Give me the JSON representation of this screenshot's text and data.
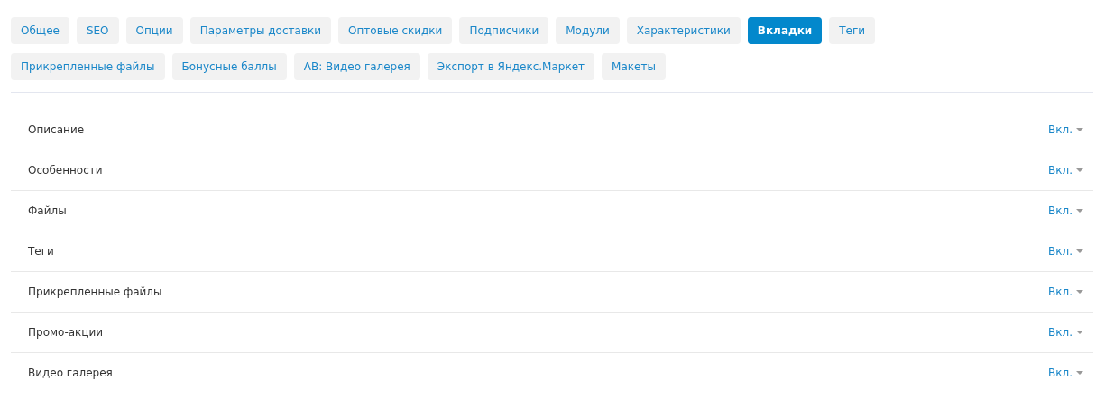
{
  "tabs": [
    {
      "label": "Общее",
      "selected": false
    },
    {
      "label": "SEO",
      "selected": false
    },
    {
      "label": "Опции",
      "selected": false
    },
    {
      "label": "Параметры доставки",
      "selected": false
    },
    {
      "label": "Оптовые скидки",
      "selected": false
    },
    {
      "label": "Подписчики",
      "selected": false
    },
    {
      "label": "Модули",
      "selected": false
    },
    {
      "label": "Характеристики",
      "selected": false
    },
    {
      "label": "Вкладки",
      "selected": true
    },
    {
      "label": "Теги",
      "selected": false
    },
    {
      "label": "Прикрепленные файлы",
      "selected": false
    },
    {
      "label": "Бонусные баллы",
      "selected": false
    },
    {
      "label": "AB: Видео галерея",
      "selected": false
    },
    {
      "label": "Экспорт в Яндекс.Маркет",
      "selected": false
    },
    {
      "label": "Макеты",
      "selected": false
    }
  ],
  "rows": [
    {
      "name": "Описание",
      "status": "Вкл."
    },
    {
      "name": "Особенности",
      "status": "Вкл."
    },
    {
      "name": "Файлы",
      "status": "Вкл."
    },
    {
      "name": "Теги",
      "status": "Вкл."
    },
    {
      "name": "Прикрепленные файлы",
      "status": "Вкл."
    },
    {
      "name": "Промо-акции",
      "status": "Вкл."
    },
    {
      "name": "Видео галерея",
      "status": "Вкл."
    }
  ]
}
